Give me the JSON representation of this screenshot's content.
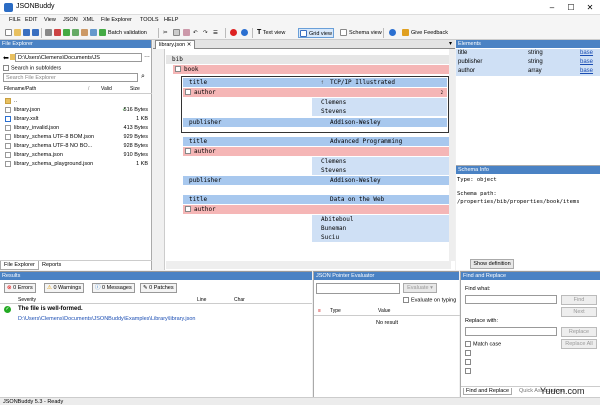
{
  "window": {
    "title": "JSONBuddy"
  },
  "menu": [
    "FILE",
    "EDIT",
    "View",
    "JSON",
    "XML",
    "File Explorer",
    "TOOLS",
    "HELP"
  ],
  "toolbar": {
    "batch_validation": "Batch validation",
    "text_view": "Text view",
    "grid_view": "Grid view",
    "schema_view": "Schema view",
    "give_feedback": "Give Feedback"
  },
  "file_explorer": {
    "title": "File Explorer",
    "path": "D:\\Users\\Clemens\\Documents\\JS",
    "search_in_subfolders": "Search in subfolders",
    "search_placeholder": "Search File Explorer",
    "columns": {
      "name": "Filename/Path",
      "valid": "Valid",
      "size": "Size"
    },
    "files": [
      {
        "name": "..",
        "valid": "",
        "size": ""
      },
      {
        "name": "library.json",
        "valid": "✓",
        "size": "516 Bytes"
      },
      {
        "name": "library.xslt",
        "valid": "",
        "size": "1 KB"
      },
      {
        "name": "library_invalid.json",
        "valid": "",
        "size": "413 Bytes"
      },
      {
        "name": "library_schema UTF-8 BOM.json",
        "valid": "",
        "size": "929 Bytes"
      },
      {
        "name": "library_schema UTF-8 NO BO...",
        "valid": "",
        "size": "928 Bytes"
      },
      {
        "name": "library_schema.json",
        "valid": "",
        "size": "910 Bytes"
      },
      {
        "name": "library_schema_playground.json",
        "valid": "",
        "size": "1 KB"
      }
    ],
    "tabs": [
      "File Explorer",
      "Reports"
    ]
  },
  "editor": {
    "tab": "library.json",
    "rows": [
      {
        "key": "bib"
      },
      {
        "key": "book"
      },
      {
        "key": "title",
        "value": "TCP/IP Illustrated"
      },
      {
        "key": "author",
        "count": "2"
      },
      {
        "value": "Clemens"
      },
      {
        "value": "Stevens"
      },
      {
        "key": "publisher",
        "value": "Addison-Wesley"
      },
      {
        "key": "title",
        "value": "Advanced Programming"
      },
      {
        "key": "author"
      },
      {
        "value": "Clemens"
      },
      {
        "value": "Stevens"
      },
      {
        "key": "publisher",
        "value": "Addison-Wesley"
      },
      {
        "key": "title",
        "value": "Data on the Web"
      },
      {
        "key": "author"
      },
      {
        "value": "Abiteboul"
      },
      {
        "value": "Buneman"
      },
      {
        "value": "Suciu"
      }
    ]
  },
  "elements": {
    "title": "Elements",
    "rows": [
      {
        "name": "title",
        "type": "string",
        "link": "base"
      },
      {
        "name": "publisher",
        "type": "string",
        "link": "base"
      },
      {
        "name": "author",
        "type": "array",
        "link": "base"
      }
    ]
  },
  "schema_info": {
    "title": "Schema Info",
    "type_line": "Type: object",
    "path_label": "Schema path:",
    "path": "/properties/bib/properties/book/items",
    "show_definition": "Show definition"
  },
  "results": {
    "title": "Results",
    "errors": "0 Errors",
    "warnings": "0 Warnings",
    "messages": "0 Messages",
    "patches": "0 Patches",
    "columns": {
      "severity": "Severity",
      "line": "Line",
      "char": "Char"
    },
    "message": "The file is well-formed.",
    "path": "D:\\Users\\Clemens\\Documents\\JSONBuddy\\Examples\\Library\\library.json"
  },
  "json_pointer": {
    "title": "JSON Pointer Evaluator",
    "evaluate": "Evaluate",
    "evaluate_on_typing": "Evaluate on typing",
    "columns": {
      "type": "Type",
      "value": "Value"
    },
    "no_result": "No result"
  },
  "find_replace": {
    "title": "Find and Replace",
    "find_what": "Find what:",
    "find_btn": "Find",
    "next_btn": "Next",
    "replace_with": "Replace with:",
    "replace_btn": "Replace",
    "replace_all_btn": "Replace All",
    "match_case": "Match case",
    "tabs": [
      "Find and Replace",
      "Quick Associations"
    ]
  },
  "status": "JSONBuddy 5.3 - Ready",
  "watermark": "Yuucn.com"
}
